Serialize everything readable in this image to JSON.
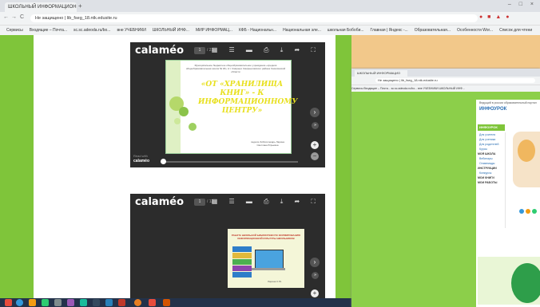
{
  "browser": {
    "tab_title": "ШКОЛЬНЫЙ ИНФОРМАЦИОН",
    "tab_close": "×",
    "new_tab": "+",
    "window_controls": "– □ ×",
    "nav": {
      "back": "←",
      "forward": "→",
      "reload": "C"
    },
    "address": "Не защищено | lib_fseg_18.ntk.edusite.ru",
    "bookmarks": [
      "Сервисы",
      "Входящие – Почта...",
      "sc.sc.adeoda.ru/bo...",
      "вне УЧЕБНИКИ",
      "ШКОЛЬНЫЙ ИНФ...",
      "МИР ИНФОРМАЦ...",
      "КФБ - Национальн...",
      "Национальная эле...",
      "школьная Бобоби...",
      "Главная | Яндекс -...",
      "Образовательная...",
      "Особенности Wor...",
      "Список для чтени"
    ]
  },
  "viewer1": {
    "logo": "calaméo",
    "page": "1",
    "page_total": "/ 21",
    "footer_small": "Read with",
    "footer_logo": "calaméo",
    "slide": {
      "header": "Муниципальное бюджетное общеобразовательное учреждение «средняя общеобразовательная школа № 18» пгт. Смирных Смирныховского района Сахалинской области",
      "title": "«ОТ «ХРАНИЛИЩА КНИГ» - К ИНФОРМАЦИОННОМУ ЦЕНТРУ»",
      "author": "педагог-библиотекарь Ларина Светлана Юрьевна"
    }
  },
  "viewer2": {
    "logo": "calaméo",
    "page": "1",
    "page_total": "/ 12",
    "slide": {
      "title": "РАБОТА ШКОЛЬНОЙ БИБЛИОТЕКИ ПО ФОРМИРОВАНИЮ ИНФОРМАЦИОННОЙ КУЛЬТУРЫ ШКОЛЬНИКОВ",
      "author": "Ларина С.Ю."
    }
  },
  "window2": {
    "tab_title": "ШКОЛЬНЫЙ ИНФОРМАЦИО",
    "address": "Не защищено | lib_fseg_18.ntk.edusite.ru",
    "bookmarks": "Сервисы  Входящие – Почта...  sc.sc.adeoda.ru/bo...  вне УЧЕБНИКИ  ШКОЛЬНЫЙ ИНФ...",
    "site_logo": "ИНФОУРОК",
    "site_tagline": "Ведущий в россии образовательный портал",
    "sidebar_heading": "ИНФОУРОК",
    "menu": [
      "Для учителя",
      "Для ученика",
      "Для родителей",
      "Курсы",
      "Вебинары",
      "Олимпиады",
      "Конкурсы"
    ],
    "sections": [
      "МОЯ ШКОЛА",
      "ИНСТРУКЦИИ",
      "МОИ КНИГИ",
      "МОИ РАБОТЫ"
    ]
  },
  "colors": {
    "page_bg": "#f2c88a",
    "green": "#7fc53a",
    "viewer_bg": "#2c2c2c",
    "slide_title": "#e8e020"
  }
}
